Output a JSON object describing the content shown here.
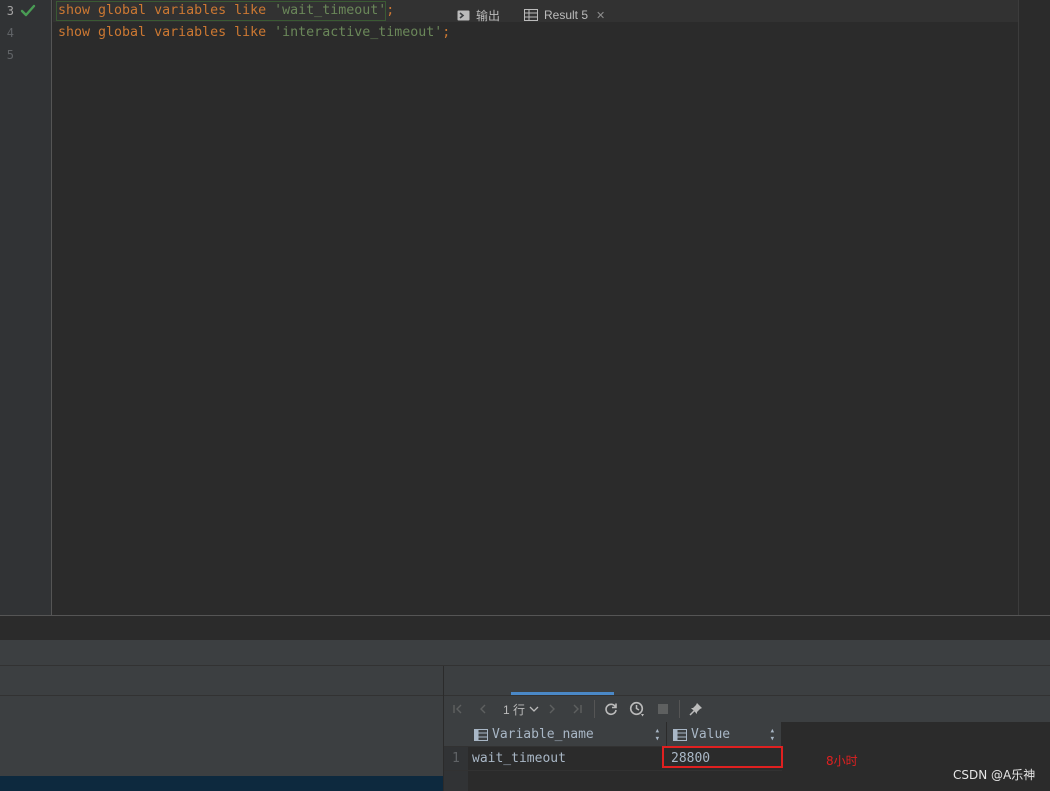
{
  "editor": {
    "line_numbers": [
      "3",
      "4",
      "5"
    ],
    "lines": [
      {
        "kw": "show global variables like",
        "str": "'wait_timeout'",
        "end": ";"
      },
      {
        "kw": "show global variables like",
        "str": "'interactive_timeout'",
        "end": ";"
      }
    ],
    "status_icon": "check-icon"
  },
  "result_panel": {
    "tabs": [
      {
        "label": "输出",
        "icon": "console-icon"
      },
      {
        "label": "Result 5",
        "icon": "table-icon",
        "close": "✕"
      }
    ],
    "toolbar": {
      "rows_label": "1 行",
      "icons": [
        "first-page-icon",
        "prev-page-icon",
        "next-page-icon",
        "last-page-icon",
        "refresh-icon",
        "history-icon",
        "stop-icon",
        "pin-icon"
      ]
    },
    "grid": {
      "columns": [
        "Variable_name",
        "Value"
      ],
      "rows": [
        {
          "num": "1",
          "cells": [
            "wait_timeout",
            "28800"
          ]
        }
      ]
    }
  },
  "annotation": "8小时",
  "watermark": "CSDN @A乐神",
  "colors": {
    "keyword": "#cc7832",
    "string": "#6a8759",
    "highlight": "#e02020",
    "accent": "#4a88c7"
  }
}
